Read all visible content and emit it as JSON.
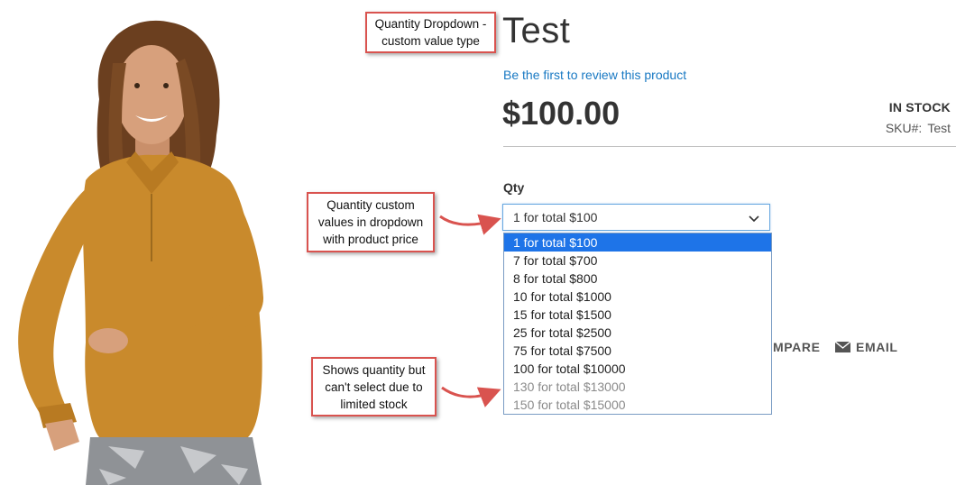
{
  "product": {
    "title": "Test",
    "review_link": "Be the first to review this product",
    "price": "$100.00",
    "stock_status": "IN STOCK",
    "sku_label": "SKU#:",
    "sku_value": "Test"
  },
  "qty": {
    "label": "Qty",
    "selected": "1 for total $100",
    "options": [
      {
        "label": "1 for total $100",
        "state": "selected"
      },
      {
        "label": "7 for total $700",
        "state": "enabled"
      },
      {
        "label": "8 for total $800",
        "state": "enabled"
      },
      {
        "label": "10 for total $1000",
        "state": "enabled"
      },
      {
        "label": "15 for total $1500",
        "state": "enabled"
      },
      {
        "label": "25 for total $2500",
        "state": "enabled"
      },
      {
        "label": "75 for total $7500",
        "state": "enabled"
      },
      {
        "label": "100 for total $10000",
        "state": "enabled"
      },
      {
        "label": "130 for total $13000",
        "state": "disabled"
      },
      {
        "label": "150 for total $15000",
        "state": "disabled"
      }
    ]
  },
  "actions": {
    "compare_label": "MPARE",
    "email_label": "EMAIL"
  },
  "annotations": {
    "dropdown_type": [
      "Quantity Dropdown -",
      "custom value type"
    ],
    "custom_values": [
      "Quantity custom",
      "values in dropdown",
      "with product price"
    ],
    "limited_stock": [
      "Shows quantity but",
      "can't select due to",
      "limited stock"
    ]
  },
  "colors": {
    "link": "#1979c3",
    "selected_option": "#1e74e8",
    "callout_border": "#d9534f",
    "shirt": "#c98a2c"
  },
  "icons": {
    "select_arrow": "chevron-down-icon",
    "email": "envelope-icon"
  }
}
